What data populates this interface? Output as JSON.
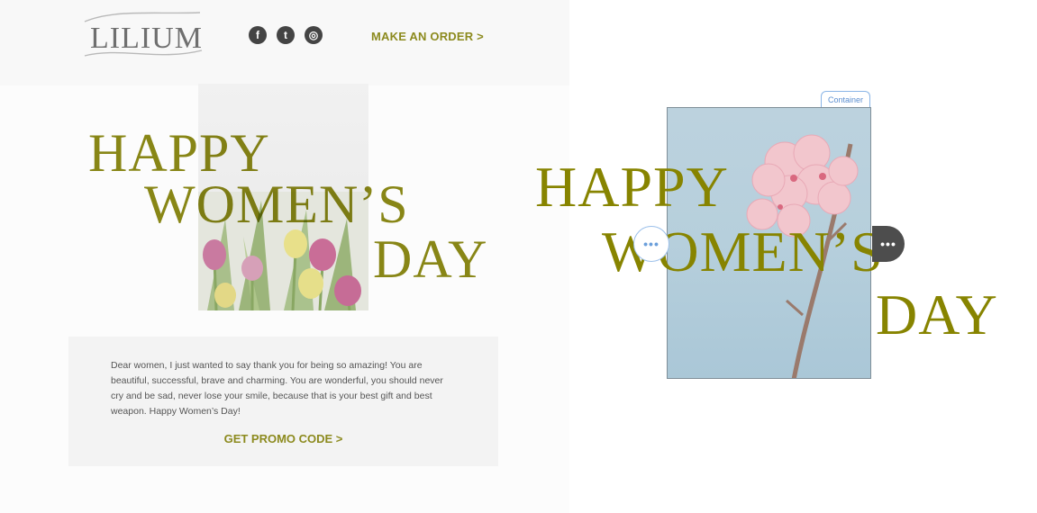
{
  "email": {
    "logo_text": "LILIUM",
    "social": [
      {
        "name": "facebook-icon",
        "glyph": "f"
      },
      {
        "name": "tumblr-icon",
        "glyph": "t"
      },
      {
        "name": "instagram-icon",
        "glyph": "◎"
      }
    ],
    "header_cta": "MAKE AN ORDER >",
    "hero_lines": [
      "HAPPY",
      "WOMEN’S",
      "DAY"
    ],
    "message": "Dear women, I just wanted to say thank you for being so amazing! You are beautiful, successful, brave and charming. You are wonderful, you should never cry and be sad, never lose your smile, because that is your best gift and best weapon. Happy Women’s Day!",
    "promo_cta": "GET PROMO CODE >"
  },
  "canvas": {
    "container_label": "Container",
    "hero_lines": [
      "HAPPY",
      "WOMEN’S",
      "DAY"
    ],
    "handle_left": "•••",
    "handle_right": "•••"
  },
  "colors": {
    "accent": "#8c8a1e",
    "sky": "#b6cfdc",
    "selection": "#8ab5e6"
  }
}
